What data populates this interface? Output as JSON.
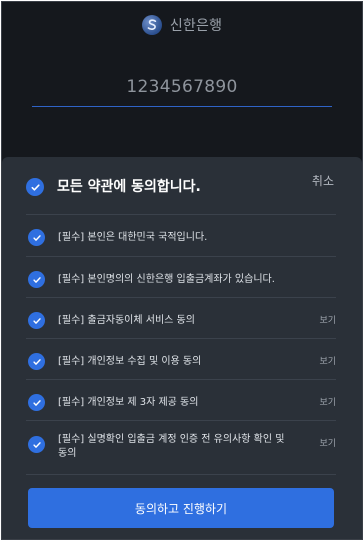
{
  "header": {
    "bank_name": "신한은행",
    "logo_icon": "shinhan-logo-icon",
    "account_number": "1234567890"
  },
  "colors": {
    "background": "#15181d",
    "sheet": "#2a3038",
    "accent": "#2f6fe0",
    "underline": "#2f63c7"
  },
  "sheet": {
    "title": "모든 약관에 동의합니다.",
    "title_checked": true,
    "cancel_label": "취소",
    "items": [
      {
        "label": "[필수] 본인은 대한민국 국적입니다.",
        "checked": true,
        "view_label": ""
      },
      {
        "label": "[필수] 본인명의의 신한은행 입출금계좌가 있습니다.",
        "checked": true,
        "view_label": ""
      },
      {
        "label": "[필수] 출금자동이체 서비스 동의",
        "checked": true,
        "view_label": "보기"
      },
      {
        "label": "[필수] 개인정보 수집 및 이용 동의",
        "checked": true,
        "view_label": "보기"
      },
      {
        "label": "[필수] 개인정보 제 3자 제공 동의",
        "checked": true,
        "view_label": "보기"
      },
      {
        "label": "[필수] 실명확인 입출금 계정 인증 전 유의사항 확인 및 동의",
        "checked": true,
        "view_label": "보기"
      }
    ],
    "submit_label": "동의하고 진행하기"
  }
}
